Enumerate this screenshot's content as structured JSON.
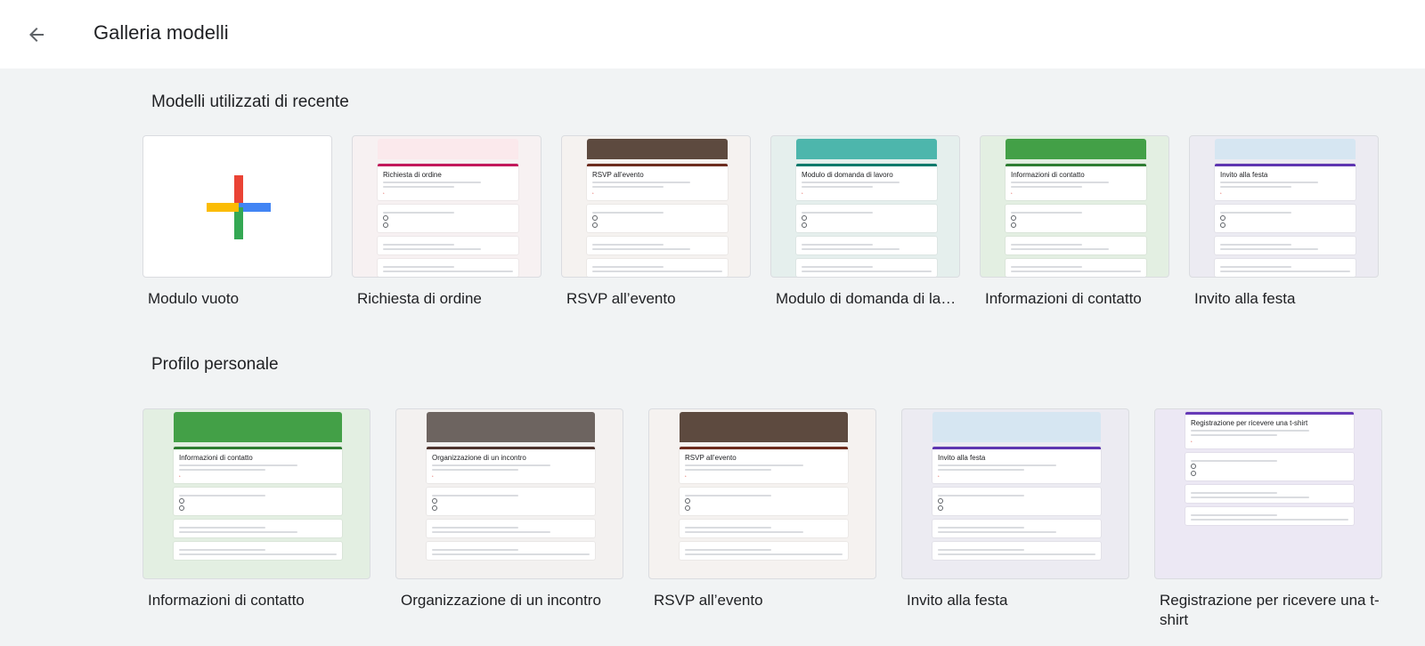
{
  "header": {
    "back_icon": "arrow-left-icon",
    "title": "Galleria modelli"
  },
  "colors": {
    "plus_red": "#ea4335",
    "plus_blue": "#4285f4",
    "plus_green": "#34a853",
    "plus_yellow": "#fbbc04"
  },
  "recent": {
    "title": "Modelli utilizzati di recente",
    "items": [
      {
        "label": "Modulo vuoto",
        "preview": {
          "kind": "blank"
        }
      },
      {
        "label": "Richiesta di ordine",
        "preview": {
          "banner": "#fbe9ec",
          "accent": "#c2185b",
          "title": "Richiesta di ordine",
          "bg": "#f7f1f2"
        }
      },
      {
        "label": "RSVP all’evento",
        "preview": {
          "banner": "#5d4a3f",
          "accent": "#6d2c1e",
          "title": "RSVP all’evento",
          "bg": "#f5f2f0"
        }
      },
      {
        "label": "Modulo di domanda di lavoro",
        "preview": {
          "banner": "#4db6ac",
          "accent": "#00796b",
          "title": "Modulo di domanda di lavoro",
          "bg": "#e5efed"
        }
      },
      {
        "label": "Informazioni di contatto",
        "preview": {
          "banner": "#43a047",
          "accent": "#2e7d32",
          "title": "Informazioni di contatto",
          "bg": "#e3efe2"
        }
      },
      {
        "label": "Invito alla festa",
        "preview": {
          "banner": "#d6e6f2",
          "accent": "#5e35b1",
          "title": "Invito alla festa",
          "bg": "#ecebf2"
        }
      }
    ]
  },
  "personal": {
    "title": "Profilo personale",
    "items": [
      {
        "label": "Informazioni di contatto",
        "preview": {
          "banner": "#43a047",
          "accent": "#2e7d32",
          "title": "Informazioni di contatto",
          "bg": "#e3efe2"
        }
      },
      {
        "label": "Organizzazione di un incontro",
        "preview": {
          "banner": "#6d6460",
          "accent": "#4e342e",
          "title": "Organizzazione di un incontro",
          "bg": "#f3f1f0"
        }
      },
      {
        "label": "RSVP all’evento",
        "preview": {
          "banner": "#5d4a3f",
          "accent": "#6d2c1e",
          "title": "RSVP all’evento",
          "bg": "#f5f2f0"
        }
      },
      {
        "label": "Invito alla festa",
        "preview": {
          "banner": "#d6e6f2",
          "accent": "#5e35b1",
          "title": "Invito alla festa",
          "bg": "#ecebf2"
        }
      },
      {
        "label": "Registrazione per ricevere una t-shirt",
        "preview": {
          "banner": "",
          "accent": "#673ab7",
          "title": "Registrazione per ricevere una t-shirt",
          "bg": "#ece8f4"
        }
      }
    ]
  }
}
